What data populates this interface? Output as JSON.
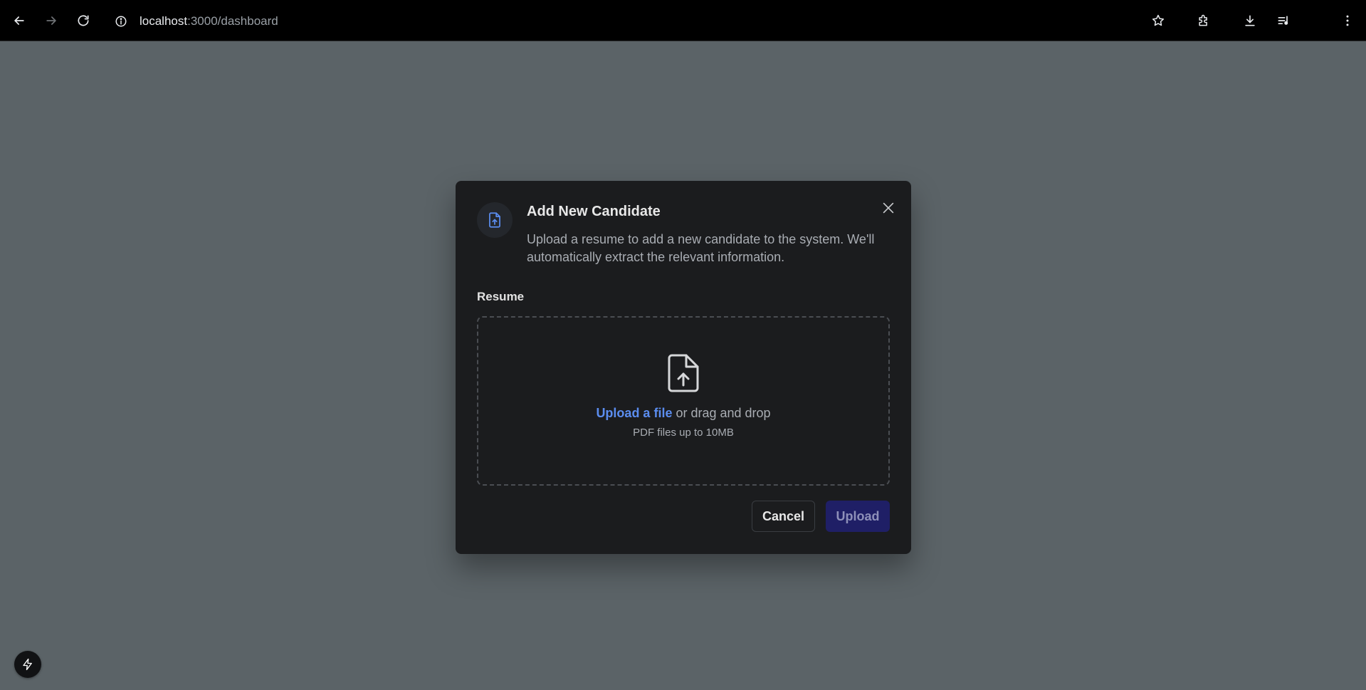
{
  "browser": {
    "url_host": "localhost",
    "url_path": ":3000/dashboard",
    "icons": [
      "back-icon",
      "forward-icon",
      "reload-icon",
      "site-info-icon",
      "bookmark-star-icon",
      "extensions-icon",
      "download-icon",
      "media-control-icon",
      "menu-icon"
    ]
  },
  "modal": {
    "title": "Add New Candidate",
    "description": "Upload a resume to add a new candidate to the system. We'll automatically extract the relevant information.",
    "field_label": "Resume",
    "upload_link": "Upload a file",
    "drag_text": " or drag and drop",
    "hint": "PDF files up to 10MB",
    "cancel_label": "Cancel",
    "upload_label": "Upload"
  },
  "colors": {
    "accent": "#5b8def",
    "upload_button_bg": "#1f1f66",
    "modal_bg": "#1b1c1e",
    "backdrop": "#5b6367"
  }
}
